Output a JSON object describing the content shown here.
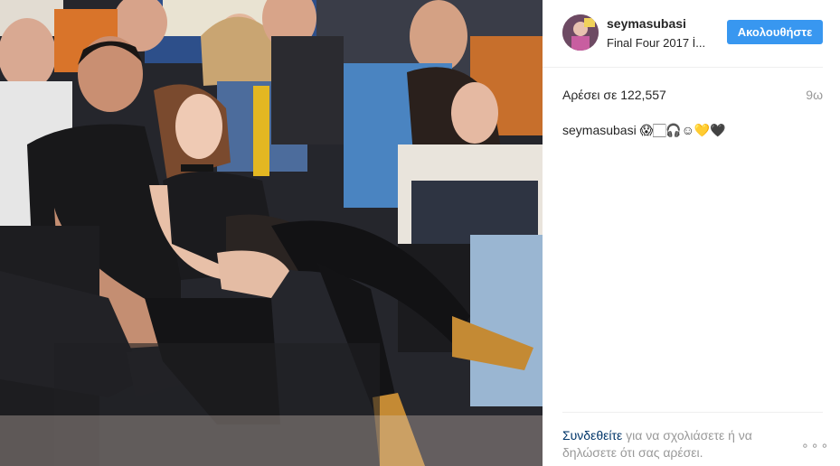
{
  "post": {
    "username": "seymasubasi",
    "location": "Final Four 2017 İ...",
    "follow_label": "Ακολουθήστε",
    "likes": "Αρέσει σε 122,557",
    "time": "9ω",
    "caption_user": "seymasubasi",
    "caption_emoji": "😱🏻🎧☺💛🖤",
    "login_link": "Συνδεθείτε",
    "login_rest": " για να σχολιάσετε ή να δηλώσετε ότι σας αρέσει.",
    "more": "∘∘∘"
  },
  "colors": {
    "accent": "#3897f0",
    "link": "#003569",
    "muted": "#999999"
  }
}
